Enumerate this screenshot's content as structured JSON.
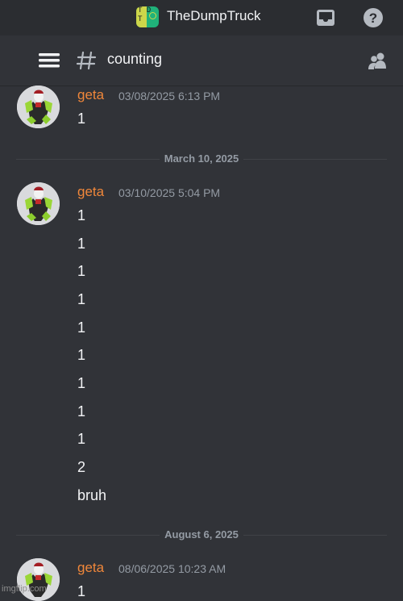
{
  "header": {
    "server_name": "TheDumpTruck",
    "server_icon_text_top": "T D",
    "server_icon_text_bottom": "T"
  },
  "channel": {
    "name": "counting"
  },
  "messages": [
    {
      "author": "geta",
      "timestamp": "03/08/2025 6:13 PM",
      "lines": [
        "1"
      ]
    },
    {
      "author": "geta",
      "timestamp": "03/10/2025 5:04 PM",
      "lines": [
        "1",
        "1",
        "1",
        "1",
        "1",
        "1",
        "1",
        "1",
        "1",
        "2",
        "bruh"
      ]
    },
    {
      "author": "geta",
      "timestamp": "08/06/2025 10:23 AM",
      "lines": [
        "1"
      ]
    }
  ],
  "dividers": [
    "March 10, 2025",
    "August 6, 2025"
  ],
  "watermark": "imgflip.com",
  "colors": {
    "background": "#313338",
    "username": "#f0873a",
    "muted": "#949ba4"
  },
  "icons": [
    "inbox-icon",
    "help-icon",
    "hamburger-menu-icon",
    "channel-hash-icon",
    "members-icon"
  ]
}
